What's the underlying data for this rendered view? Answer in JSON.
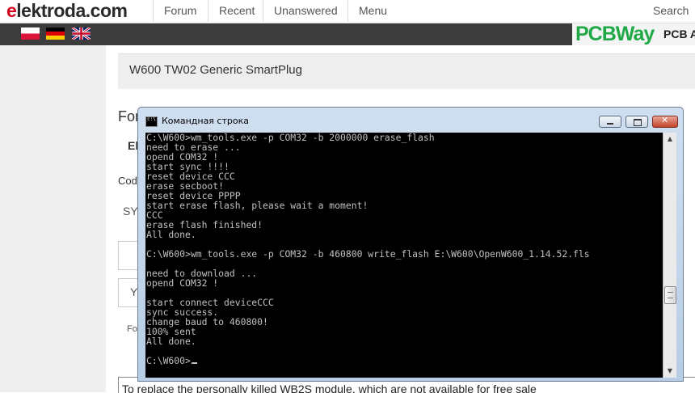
{
  "site": {
    "logo_first": "e",
    "logo_rest": "lektroda.com",
    "nav": [
      "Forum",
      "Recent",
      "Unanswered",
      "Menu"
    ],
    "search_label": "Search"
  },
  "flags": [
    "poland-flag",
    "germany-flag",
    "uk-flag"
  ],
  "ad": {
    "brand": "PCBWay",
    "tagline": "PCB A"
  },
  "thread": {
    "title": "W600 TW02 Generic SmartPlug",
    "peek": {
      "forum": "For",
      "e": "El",
      "code": "Cod",
      "sy": "SY",
      "y": "Y",
      "fo": "Fo"
    },
    "bottom_text": "To replace the personally killed WB2S module, which are not available for free sale"
  },
  "console_window": {
    "title": "Командная строка",
    "lines": [
      "C:\\W600>wm_tools.exe -p COM32 -b 2000000 erase_flash",
      "need to erase ...",
      "opend COM32 !",
      "start sync !!!!",
      "reset device CCC",
      "erase secboot!",
      "reset device PPPP",
      "start erase flash, please wait a moment!",
      "CCC",
      "erase flash finished!",
      "All done.",
      "",
      "C:\\W600>wm_tools.exe -p COM32 -b 460800 write_flash E:\\W600\\OpenW600_1.14.52.fls",
      "",
      "need to download ...",
      "opend COM32 !",
      "",
      "start connect deviceCCC",
      "sync success.",
      "change baud to 460800!",
      "100% sent",
      "All done.",
      "",
      "C:\\W600>"
    ]
  }
}
